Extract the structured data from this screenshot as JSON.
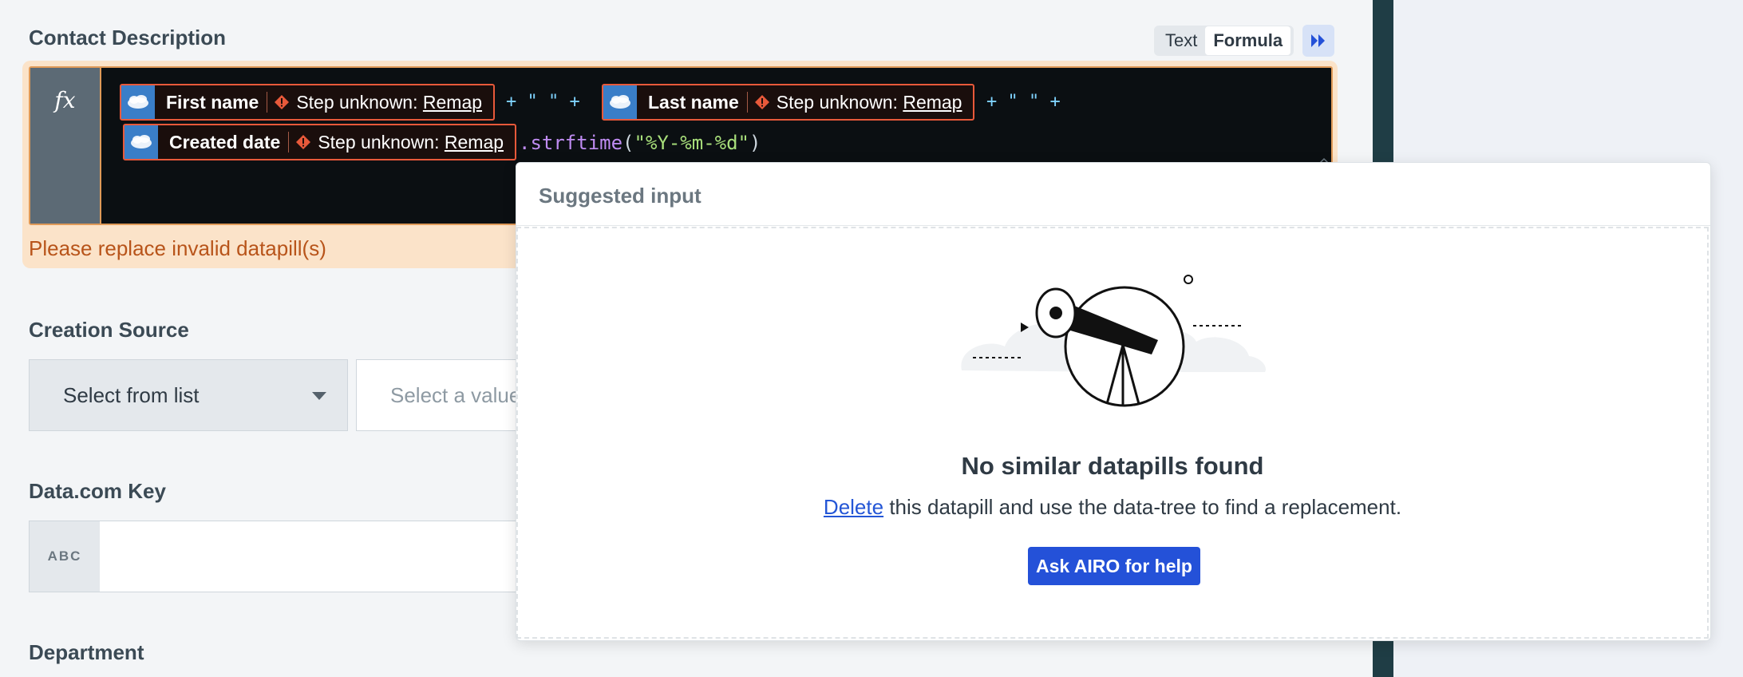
{
  "fields": {
    "contact_description": {
      "label": "Contact Description"
    },
    "creation_source": {
      "label": "Creation Source",
      "select_label": "Select from list",
      "value_placeholder": "Select a value"
    },
    "datacom_key": {
      "label": "Data.com Key",
      "type_badge": "ABC"
    },
    "department": {
      "label": "Department"
    }
  },
  "mode_toggle": {
    "text": "Text",
    "formula": "Formula",
    "active": "Formula"
  },
  "formula": {
    "fx_label": "fx",
    "pills": [
      {
        "name": "First name",
        "step": "Step unknown:",
        "action": "Remap",
        "source_icon": "salesforce-icon"
      },
      {
        "name": "Last name",
        "step": "Step unknown:",
        "action": "Remap",
        "source_icon": "salesforce-icon"
      },
      {
        "name": "Created date",
        "step": "Step unknown:",
        "action": "Remap",
        "source_icon": "salesforce-icon"
      }
    ],
    "operator1": "+ \" \" +",
    "operator2": "+ \" \" +",
    "method": ".strftime",
    "paren_open": "(",
    "arg": "\"%Y-%m-%d\"",
    "paren_close": ")"
  },
  "error": "Please replace invalid datapill(s)",
  "suggested_input": {
    "title": "Suggested input",
    "empty_title": "No similar datapills found",
    "delete_link": "Delete",
    "empty_desc": "this datapill and use the data-tree to find a replacement.",
    "button": "Ask AIRO for help"
  },
  "colors": {
    "accent": "#2451d8",
    "error": "#b8541a",
    "pill_border": "#e8593a",
    "sidebar_divider": "#1f3d45"
  }
}
